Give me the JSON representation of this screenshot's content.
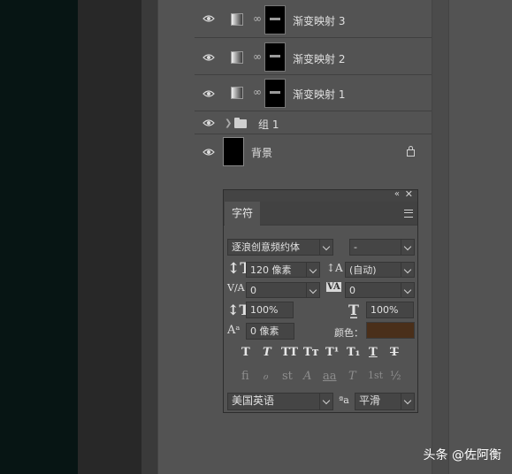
{
  "layers": [
    {
      "name": "渐变映射 3",
      "type": "adjustment"
    },
    {
      "name": "渐变映射 2",
      "type": "adjustment"
    },
    {
      "name": "渐变映射 1",
      "type": "adjustment"
    },
    {
      "name": "组 1",
      "type": "group"
    },
    {
      "name": "背景",
      "type": "background",
      "locked": true
    }
  ],
  "character_panel": {
    "tab_label": "字符",
    "font_family": "逐浪创意频约体",
    "font_style": "-",
    "font_size": "120 像素",
    "leading": "(自动)",
    "kerning": "0",
    "tracking": "0",
    "vertical_scale": "100%",
    "horizontal_scale": "100%",
    "baseline_shift": "0 像素",
    "color_label": "颜色：",
    "color": "#4a2f1a",
    "language": "美国英语",
    "antialias": "平滑",
    "style_buttons": [
      "T",
      "T",
      "TT",
      "Tт",
      "T¹",
      "T₁",
      "T",
      "T"
    ],
    "opentype_buttons": [
      "fi",
      "ℴ",
      "st",
      "A",
      "aa",
      "T",
      "1st",
      "½"
    ]
  },
  "watermark": "头条 @佐阿衡"
}
